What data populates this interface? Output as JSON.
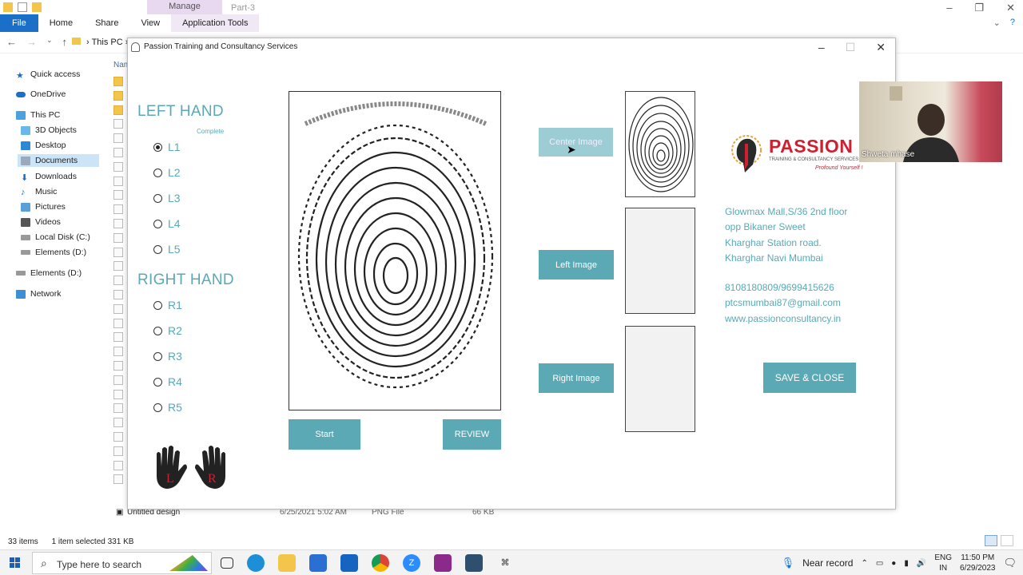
{
  "explorer": {
    "manage_tab": "Manage",
    "window_title": "Part-3",
    "ribbon_tabs": [
      "File",
      "Home",
      "Share",
      "View",
      "Application Tools"
    ],
    "breadcrumb": "This PC",
    "name_header": "Nam",
    "nav_items": [
      "Quick access",
      "OneDrive",
      "This PC",
      "3D Objects",
      "Desktop",
      "Documents",
      "Downloads",
      "Music",
      "Pictures",
      "Videos",
      "Local Disk (C:)",
      "Elements (D:)",
      "Elements (D:)",
      "Network"
    ],
    "selected_row": {
      "name": "Untitled design",
      "date": "6/25/2021 5:02 AM",
      "type": "PNG File",
      "size": "66 KB"
    },
    "status_items": "33 items",
    "status_selected": "1 item selected  331 KB"
  },
  "app": {
    "title": "Passion Training and Consultancy Services",
    "left_hand_title": "LEFT HAND",
    "complete_label": "Complete",
    "left_fingers": [
      "L1",
      "L2",
      "L3",
      "L4",
      "L5"
    ],
    "selected_finger": "L1",
    "right_hand_title": "RIGHT HAND",
    "right_fingers": [
      "R1",
      "R2",
      "R3",
      "R4",
      "R5"
    ],
    "buttons": {
      "center_image": "Center Image",
      "left_image": "Left Image",
      "right_image": "Right Image",
      "start": "Start",
      "review": "REVIEW",
      "save_close": "SAVE  &  CLOSE"
    },
    "logo": {
      "name": "PASSION",
      "sub": "TRAINING & CONSULTANCY SERVICES",
      "tagline": "Profound Yourself !"
    },
    "hand_letters": [
      "L",
      "R"
    ],
    "address": [
      "Glowmax Mall,S/36 2nd floor",
      "opp Bikaner Sweet",
      "Kharghar Station road.",
      "Kharghar Navi Mumbai"
    ],
    "contact": [
      "8108180809/9699415626",
      "ptcsmumbai87@gmail.com",
      "www.passionconsultancy.in"
    ]
  },
  "webcam": {
    "caption": "Shweta mhase"
  },
  "taskbar": {
    "search_placeholder": "Type here to search",
    "near_record": "Near record",
    "lang": "ENG",
    "region": "IN",
    "time": "11:50 PM",
    "date": "6/29/2023"
  },
  "colors": {
    "accent": "#5aa9b4",
    "brand_red": "#d21f2f",
    "ribbon_file": "#1a6fc9"
  }
}
